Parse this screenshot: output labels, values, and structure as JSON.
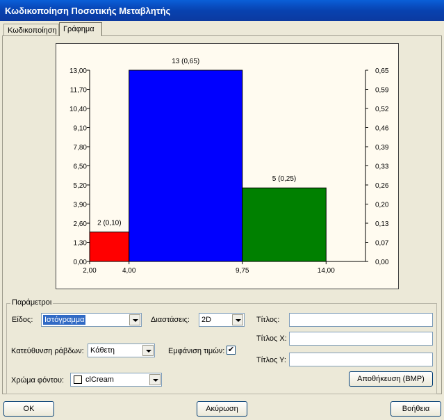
{
  "window": {
    "title": "Κωδικοποίηση Ποσοτικής Μεταβλητής"
  },
  "tabs": [
    {
      "label": "Κωδικοποίηση",
      "active": false
    },
    {
      "label": "Γράφημα",
      "active": true
    }
  ],
  "chart_data": {
    "type": "bar",
    "subtype": "histogram",
    "title": "",
    "xlabel": "",
    "ylabel": "",
    "bins": [
      {
        "from": 2.0,
        "to": 4.0,
        "count": 2,
        "proportion": 0.1,
        "label": "2 (0,10)",
        "color": "#ff0000"
      },
      {
        "from": 4.0,
        "to": 9.75,
        "count": 13,
        "proportion": 0.65,
        "label": "13 (0,65)",
        "color": "#0000ff"
      },
      {
        "from": 9.75,
        "to": 14.0,
        "count": 5,
        "proportion": 0.25,
        "label": "5 (0,25)",
        "color": "#008000"
      }
    ],
    "x_ticks": [
      "2,00",
      "4,00",
      "9,75",
      "14,00"
    ],
    "xlim": [
      2.0,
      16.0
    ],
    "ylim": [
      0,
      13.0
    ],
    "y_ticks": [
      "0,00",
      "1,30",
      "2,60",
      "3,90",
      "5,20",
      "6,50",
      "7,80",
      "9,10",
      "10,40",
      "11,70",
      "13,00"
    ],
    "ylim_right": [
      0,
      0.65
    ],
    "y_ticks_right": [
      "0,00",
      "0,07",
      "0,13",
      "0,20",
      "0,26",
      "0,33",
      "0,39",
      "0,46",
      "0,52",
      "0,59",
      "0,65"
    ],
    "grid": false,
    "legend": "none",
    "background": "#fffbf0"
  },
  "params": {
    "group_title": "Παράμετροι",
    "type_label": "Είδος:",
    "type_value": "Ιστόγραμμα",
    "dimensions_label": "Διαστάσεις:",
    "dimensions_value": "2D",
    "bar_direction_label": "Κατεύθυνση ράβδων:",
    "bar_direction_value": "Κάθετη",
    "show_values_label": "Εμφάνιση τιμών:",
    "show_values_checked": "✔",
    "bg_color_label": "Χρώμα φόντου:",
    "bg_color_value": "clCream",
    "title_label": "Τίτλος:",
    "title_x_label": "Τίτλος Χ:",
    "title_y_label": "Τίτλος Υ:",
    "title_value": "",
    "title_x_value": "",
    "title_y_value": "",
    "save_button": "Αποθήκευση (BMP)"
  },
  "footer": {
    "ok_button": "OK",
    "cancel_button": "Ακύρωση",
    "help_button": "Βοήθεια"
  }
}
